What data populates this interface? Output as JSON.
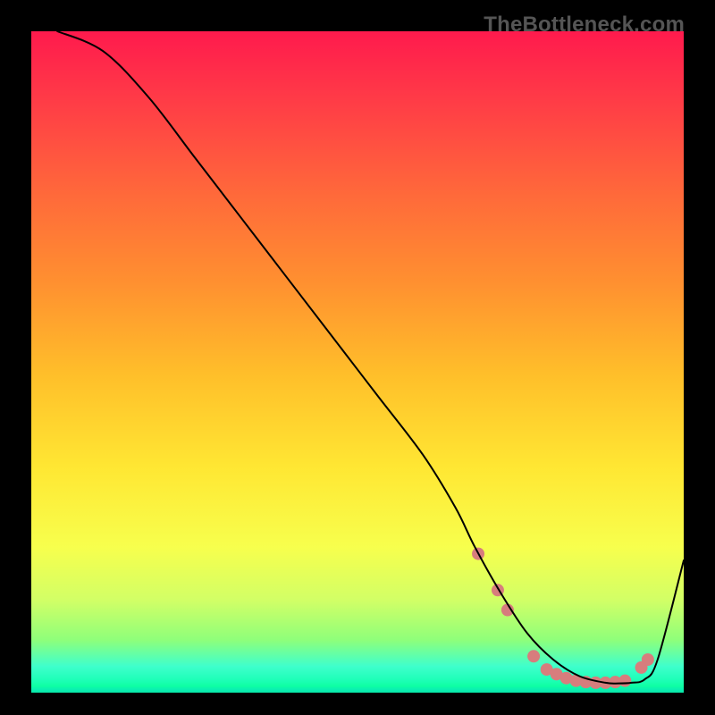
{
  "attribution": "TheBottleneck.com",
  "chart_data": {
    "type": "line",
    "title": "",
    "xlabel": "",
    "ylabel": "",
    "xlim": [
      0,
      100
    ],
    "ylim": [
      0,
      100
    ],
    "grid": false,
    "legend": false,
    "series": [
      {
        "name": "curve",
        "x": [
          4,
          11,
          18,
          25,
          32,
          39,
          46,
          53,
          60,
          65,
          68,
          72,
          76,
          80,
          84,
          88,
          90,
          92,
          94,
          96,
          100
        ],
        "y": [
          100,
          97,
          90,
          81,
          72,
          63,
          54,
          45,
          36,
          28,
          22,
          15,
          9,
          5,
          2.5,
          1.5,
          1.4,
          1.5,
          2,
          5,
          20
        ],
        "color": "#000000",
        "width": 2
      }
    ],
    "markers": [
      {
        "x": 68.5,
        "y": 21.0,
        "r": 7,
        "color": "#d77d7d"
      },
      {
        "x": 71.5,
        "y": 15.5,
        "r": 7,
        "color": "#d77d7d"
      },
      {
        "x": 73.0,
        "y": 12.5,
        "r": 7,
        "color": "#d77d7d"
      },
      {
        "x": 77.0,
        "y": 5.5,
        "r": 7,
        "color": "#d77d7d"
      },
      {
        "x": 79.0,
        "y": 3.5,
        "r": 7,
        "color": "#d77d7d"
      },
      {
        "x": 80.5,
        "y": 2.8,
        "r": 7,
        "color": "#d77d7d"
      },
      {
        "x": 82.0,
        "y": 2.2,
        "r": 7,
        "color": "#d77d7d"
      },
      {
        "x": 83.5,
        "y": 1.8,
        "r": 7,
        "color": "#d77d7d"
      },
      {
        "x": 85.0,
        "y": 1.6,
        "r": 7,
        "color": "#d77d7d"
      },
      {
        "x": 86.5,
        "y": 1.5,
        "r": 7,
        "color": "#d77d7d"
      },
      {
        "x": 88.0,
        "y": 1.5,
        "r": 7,
        "color": "#d77d7d"
      },
      {
        "x": 89.5,
        "y": 1.6,
        "r": 7,
        "color": "#d77d7d"
      },
      {
        "x": 91.0,
        "y": 1.8,
        "r": 7,
        "color": "#d77d7d"
      },
      {
        "x": 93.5,
        "y": 3.8,
        "r": 7,
        "color": "#d77d7d"
      },
      {
        "x": 94.5,
        "y": 5.0,
        "r": 7,
        "color": "#d77d7d"
      }
    ],
    "background_gradient": {
      "orientation": "vertical",
      "stops": [
        {
          "pos": 0,
          "color": "#ff1a4d"
        },
        {
          "pos": 25,
          "color": "#ff6a3a"
        },
        {
          "pos": 52,
          "color": "#ffbf2a"
        },
        {
          "pos": 78,
          "color": "#f7ff4d"
        },
        {
          "pos": 92,
          "color": "#8fff7a"
        },
        {
          "pos": 100,
          "color": "#09e8a8"
        }
      ]
    }
  }
}
